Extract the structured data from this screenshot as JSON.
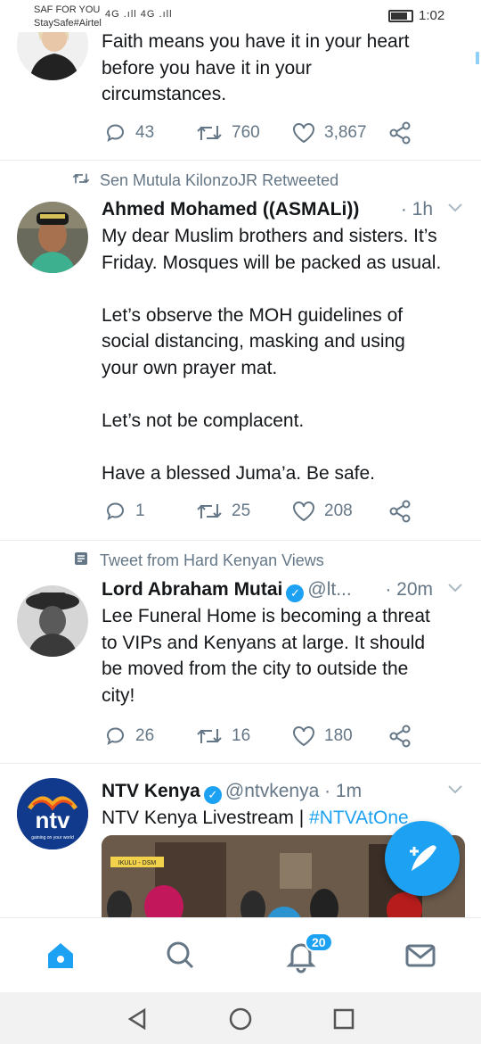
{
  "status_bar": {
    "carrier_line1": "SAF FOR YOU",
    "carrier_line2": "StaySafe#Airtel",
    "signal": "4G .ıll 4G .ıll",
    "time": "1:02"
  },
  "tweets": [
    {
      "body": "Faith means you have it in your heart\nbefore you have it in your\ncircumstances.",
      "replies": "43",
      "retweets": "760",
      "likes": "3,867"
    },
    {
      "context": "Sen Mutula KilonzoJR Retweeted",
      "context_icon": "retweet-icon",
      "name": "Ahmed Mohamed ((ASMALi))",
      "time": "· 1h",
      "body": "My dear Muslim brothers and sisters. It’s\nFriday. Mosques will be packed as usual.\n\nLet’s observe the MOH guidelines of\nsocial distancing, masking and using\nyour own prayer mat.\n\nLet’s not be complacent.\n\nHave a blessed Juma’a. Be safe.",
      "replies": "1",
      "retweets": "25",
      "likes": "208"
    },
    {
      "context": "Tweet from Hard Kenyan Views",
      "context_icon": "list-icon",
      "name": "Lord Abraham Mutai",
      "handle": "@lt...",
      "time": "· 20m",
      "body": "Lee Funeral Home is becoming a threat\nto VIPs and Kenyans at large. It should\nbe moved from the city to outside the\ncity!",
      "replies": "26",
      "retweets": "16",
      "likes": "180"
    },
    {
      "name": "NTV Kenya",
      "handle": "@ntvkenya",
      "time": "· 1m",
      "body": "NTV Kenya Livestream | ",
      "hashtag": "#NTVAtOne",
      "avatar_text": "ntv",
      "avatar_tagline": "gaining on your world",
      "media_caption": "IKULU - DSM"
    }
  ],
  "bottom_nav": {
    "notifications_badge": "20"
  },
  "colors": {
    "accent": "#1da1f2",
    "text": "#14171a",
    "secondary": "#657786"
  }
}
